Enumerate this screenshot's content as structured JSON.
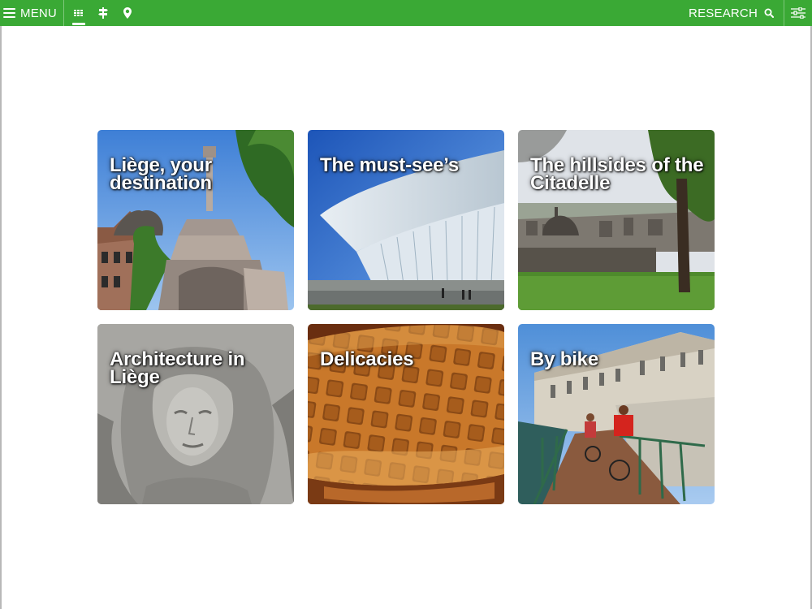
{
  "header": {
    "menu_label": "MENU",
    "research_label": "RESEARCH",
    "views": [
      {
        "icon": "grid-view-icon",
        "active": true
      },
      {
        "icon": "signpost-icon",
        "active": false
      },
      {
        "icon": "map-pin-icon",
        "active": false
      }
    ],
    "filter_icon": "filter-sliders-icon"
  },
  "colors": {
    "header_bg": "#3aa935",
    "header_text": "#ffffff",
    "page_bg": "#ffffff"
  },
  "tiles": [
    {
      "title": "Liège, your destination",
      "image": "liege-perron-fountain"
    },
    {
      "title": "The must-see’s",
      "image": "guillemins-station-roof"
    },
    {
      "title": "The hillsides of the Citadelle",
      "image": "citadelle-hillside-view"
    },
    {
      "title": "Architecture in Liège",
      "image": "art-nouveau-stone-face"
    },
    {
      "title": "Delicacies",
      "image": "liege-waffles"
    },
    {
      "title": "By bike",
      "image": "cyclists-riverside-path"
    }
  ]
}
